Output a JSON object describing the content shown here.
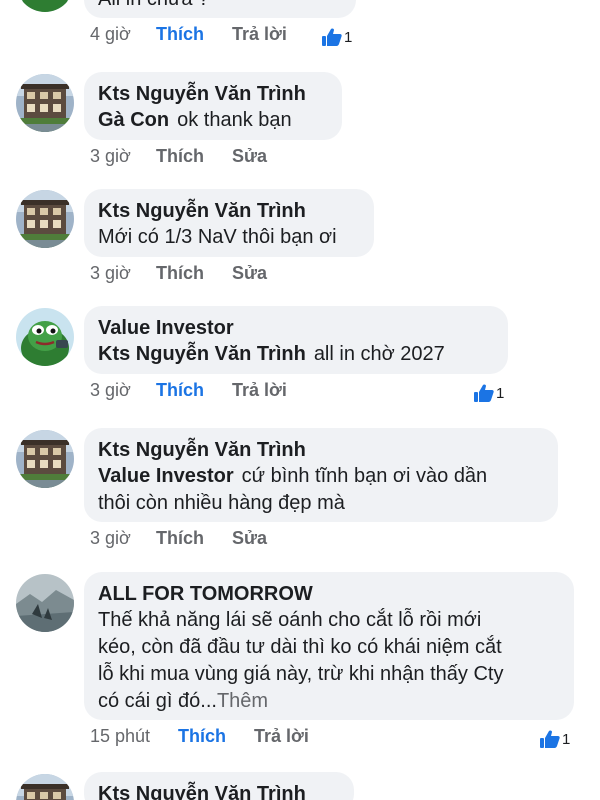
{
  "comments": [
    {
      "text": "All in chưa ?",
      "time": "4 giờ",
      "like": "Thích",
      "action2": "Trả lời",
      "reactions": "1"
    },
    {
      "author": "Kts Nguyễn Văn Trình",
      "mention": "Gà Con",
      "text": "ok thank bạn",
      "time": "3 giờ",
      "like": "Thích",
      "action2": "Sửa"
    },
    {
      "author": "Kts Nguyễn Văn Trình",
      "text": "Mới có 1/3 NaV thôi bạn ơi",
      "time": "3 giờ",
      "like": "Thích",
      "action2": "Sửa"
    },
    {
      "author": "Value Investor",
      "mention": "Kts Nguyễn Văn Trình",
      "text": "all in chờ 2027",
      "time": "3 giờ",
      "like": "Thích",
      "action2": "Trả lời",
      "reactions": "1"
    },
    {
      "author": "Kts Nguyễn Văn Trình",
      "mention": "Value Investor",
      "text": "cứ bình tĩnh bạn ơi vào dần",
      "text2": "thôi còn nhiều hàng đẹp mà",
      "time": "3 giờ",
      "like": "Thích",
      "action2": "Sửa"
    },
    {
      "author": "ALL FOR TOMORROW",
      "lines": [
        "Thế khả năng lái sẽ oánh cho cắt lỗ rồi mới",
        "kéo, còn đã đầu tư dài thì ko có khái niệm cắt",
        "lỗ khi mua vùng giá này, trừ khi nhận thấy Cty",
        "có cái gì đó..."
      ],
      "more": "Thêm",
      "time": "15 phút",
      "like": "Thích",
      "action2": "Trả lời",
      "reactions": "1"
    },
    {
      "author": "Kts Nguyễn Văn Trình"
    }
  ],
  "colors": {
    "bubble": "#f0f2f5",
    "like_active": "#1b74e4",
    "muted": "#65676b"
  },
  "icons": {
    "reaction": "thumbs-up-icon",
    "avatar_trinh": "house-photo-avatar",
    "avatar_value": "green-frog-avatar",
    "avatar_allfor": "landscape-avatar"
  }
}
